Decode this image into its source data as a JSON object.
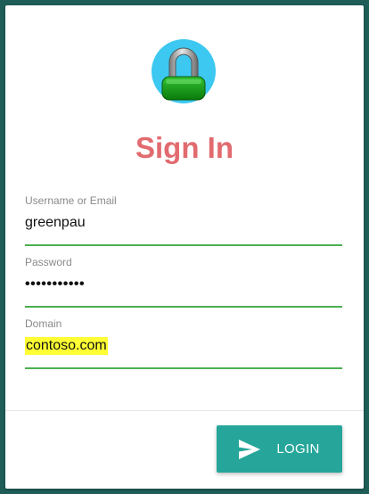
{
  "title": "Sign In",
  "logo_icon": "padlock-icon",
  "fields": {
    "username": {
      "label": "Username or Email",
      "value": "greenpau"
    },
    "password": {
      "label": "Password",
      "value": "•••••••••••"
    },
    "domain": {
      "label": "Domain",
      "value": "contoso.com"
    }
  },
  "login_button": {
    "label": "LOGIN",
    "icon": "send-icon"
  },
  "colors": {
    "background": "#1f5e58",
    "title": "#e16b6f",
    "accent_underline": "#4caf50",
    "button": "#26a69a",
    "highlight": "#ffff33"
  }
}
